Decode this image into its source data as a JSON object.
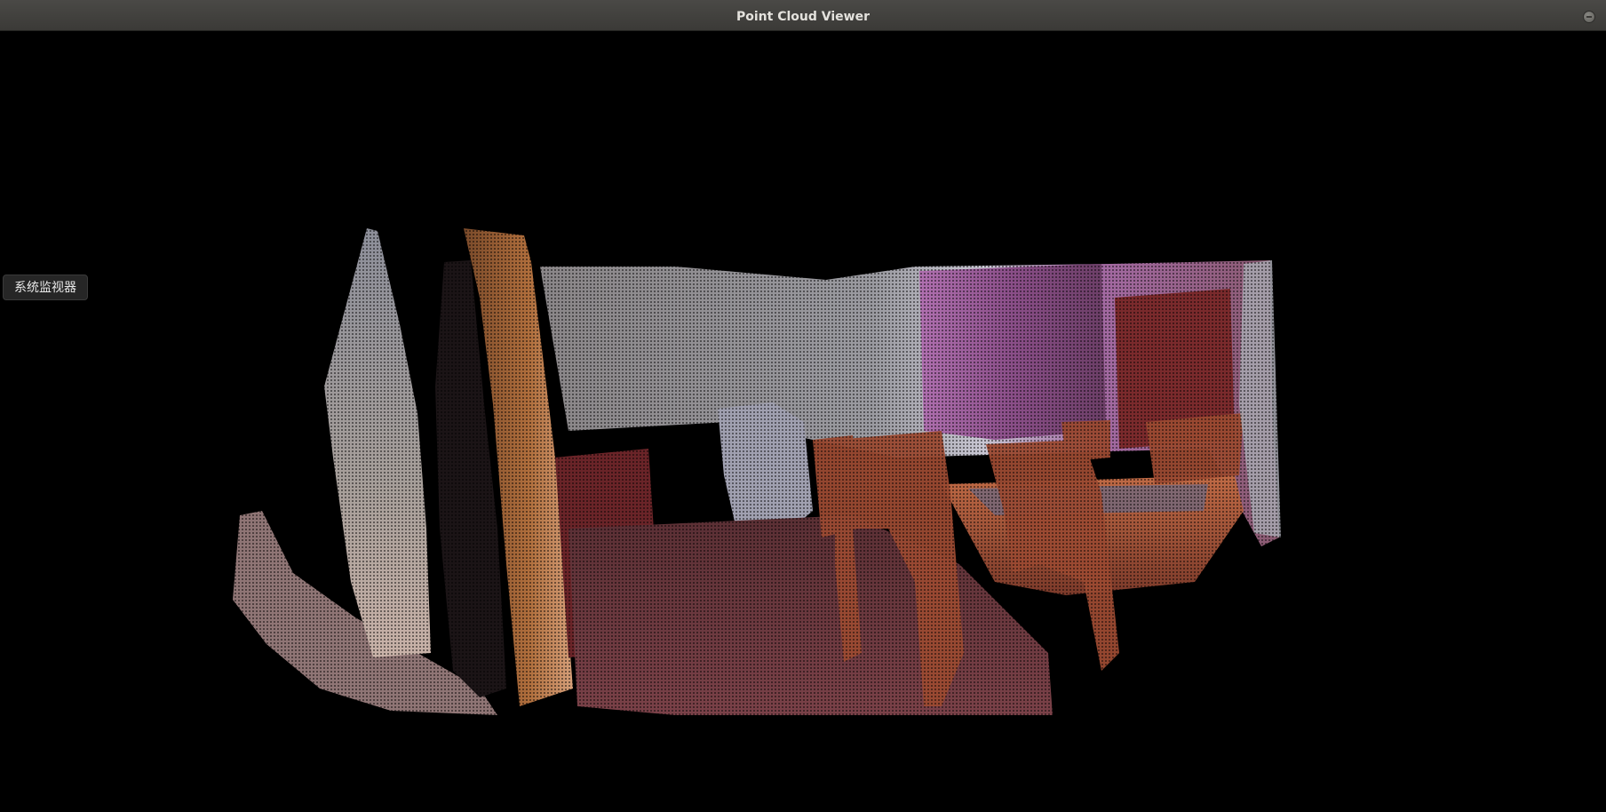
{
  "window": {
    "title": "Point Cloud Viewer"
  },
  "tooltip": {
    "text": "系统监视器"
  },
  "icons": {
    "close": "window-close-icon"
  },
  "colors": {
    "background": "#000000",
    "titlebar": "#3f3e3b",
    "title_text": "#e4e2dd"
  }
}
